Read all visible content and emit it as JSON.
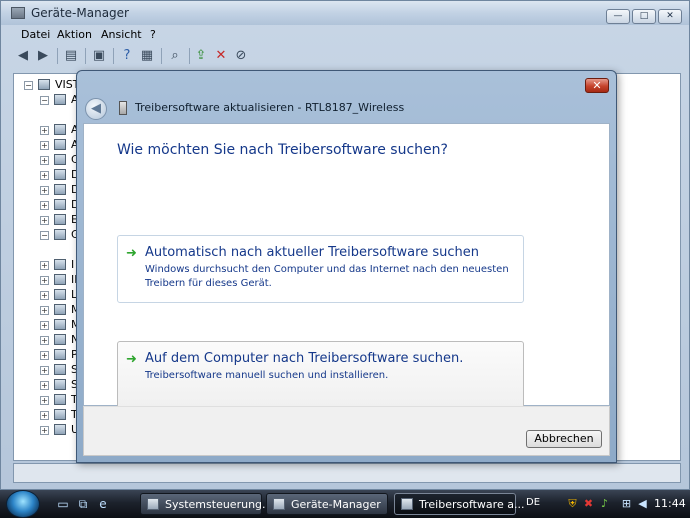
{
  "main_window": {
    "title": "Geräte-Manager",
    "controls": {
      "minimize": "—",
      "maximize": "□",
      "close": "✕"
    },
    "menu": [
      "Datei",
      "Aktion",
      "Ansicht",
      "?"
    ],
    "toolbar_icons": [
      "back-icon",
      "forward-icon",
      "properties-icon",
      "show-hide-icon",
      "help-icon",
      "view-icon",
      "scan-icon",
      "update-driver-icon",
      "uninstall-icon",
      "disable-icon"
    ],
    "tree": {
      "root": "VISTA",
      "items": [
        "A",
        "A",
        "A",
        "C",
        "D",
        "D",
        "D",
        "E",
        "G",
        "I",
        "IE",
        "L",
        "M",
        "M",
        "N",
        "P",
        "S",
        "S",
        "T",
        "T",
        "U"
      ]
    }
  },
  "wizard": {
    "title": "Treibersoftware aktualisieren - RTL8187_Wireless",
    "close_label": "✕",
    "heading": "Wie möchten Sie nach Treibersoftware suchen?",
    "options": [
      {
        "title": "Automatisch nach aktueller Treibersoftware suchen",
        "description": "Windows durchsucht den Computer und das Internet nach den neuesten Treibern für dieses Gerät."
      },
      {
        "title": "Auf dem Computer nach Treibersoftware suchen.",
        "description": "Treibersoftware manuell suchen und installieren."
      }
    ],
    "cancel_label": "Abbrechen"
  },
  "taskbar": {
    "tasks": [
      {
        "label": "Systemsteuerung...",
        "active": false
      },
      {
        "label": "Geräte-Manager",
        "active": false
      },
      {
        "label": "Treibersoftware a...",
        "active": true
      }
    ],
    "language": "DE",
    "clock": "11:44"
  },
  "colors": {
    "heading_blue": "#15388a",
    "arrow_green": "#2ea52e",
    "close_red": "#c6432c"
  }
}
